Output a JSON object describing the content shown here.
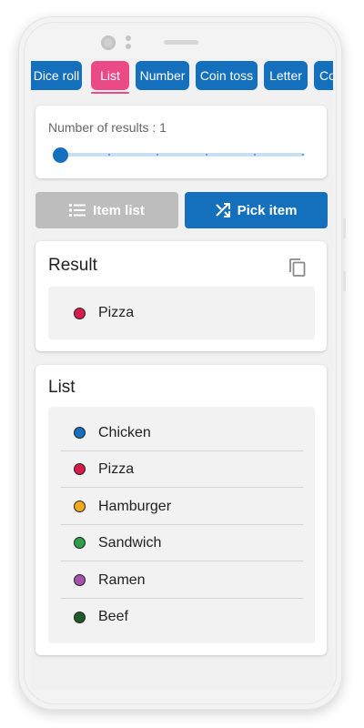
{
  "tabs": [
    {
      "label": "Dice roll",
      "active": false
    },
    {
      "label": "List",
      "active": true
    },
    {
      "label": "Number",
      "active": false
    },
    {
      "label": "Coin toss",
      "active": false
    },
    {
      "label": "Letter",
      "active": false
    },
    {
      "label": "Co",
      "active": false
    }
  ],
  "results_count": {
    "label": "Number of results : 1",
    "value": 1,
    "slider_fraction": 0.0,
    "tick_count": 6
  },
  "actions": {
    "item_list_label": "Item list",
    "item_list_icon": "list-icon",
    "item_list_enabled": false,
    "pick_item_label": "Pick item",
    "pick_item_icon": "shuffle-icon"
  },
  "result": {
    "title": "Result",
    "copy_icon": "copy-icon",
    "items": [
      {
        "label": "Pizza",
        "color": "#d81b4a"
      }
    ]
  },
  "list": {
    "title": "List",
    "items": [
      {
        "label": "Chicken",
        "color": "#1470bd"
      },
      {
        "label": "Pizza",
        "color": "#d81b4a"
      },
      {
        "label": "Hamburger",
        "color": "#f0a81c"
      },
      {
        "label": "Sandwich",
        "color": "#2e9e4a"
      },
      {
        "label": "Ramen",
        "color": "#a352ad"
      },
      {
        "label": "Beef",
        "color": "#1e5a2c"
      }
    ]
  },
  "colors": {
    "accent": "#1470bd",
    "active_tab": "#ea4a86",
    "disabled_button": "#bdbdbd"
  }
}
